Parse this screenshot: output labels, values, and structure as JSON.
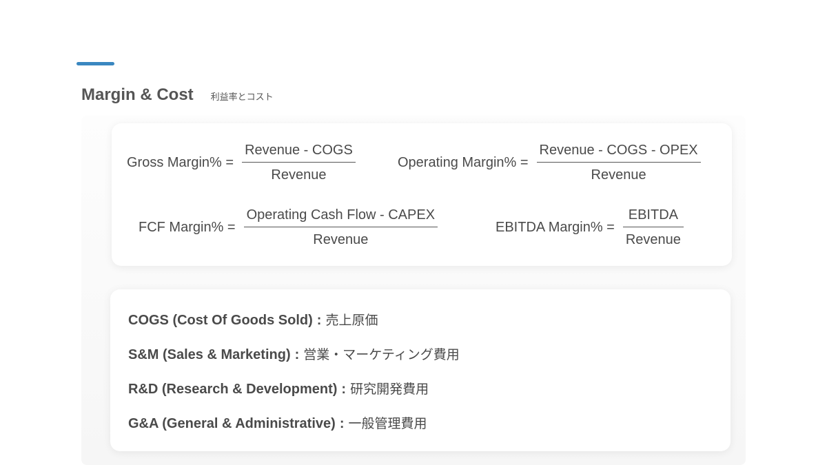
{
  "section": {
    "title": "Margin & Cost",
    "subtitle": "利益率とコスト",
    "accent_color": "#3a87c0"
  },
  "formulas": [
    {
      "lhs": "Gross Margin% =",
      "numerator": "Revenue - COGS",
      "denominator": "Revenue"
    },
    {
      "lhs": "Operating Margin% =",
      "numerator": "Revenue - COGS - OPEX",
      "denominator": "Revenue"
    },
    {
      "lhs": "FCF Margin% =",
      "numerator": "Operating Cash Flow - CAPEX",
      "denominator": "Revenue"
    },
    {
      "lhs": "EBITDA Margin% =",
      "numerator": "EBITDA",
      "denominator": "Revenue"
    }
  ],
  "glossary": [
    {
      "term": "COGS (Cost Of Goods Sold)",
      "separator": ":",
      "japanese": "売上原価"
    },
    {
      "term": "S&M (Sales & Marketing)",
      "separator": ":",
      "japanese": "営業・マーケティング費用"
    },
    {
      "term": "R&D (Research & Development)",
      "separator": ":",
      "japanese": "研究開発費用"
    },
    {
      "term": "G&A (General & Administrative)",
      "separator": ":",
      "japanese": "一般管理費用"
    }
  ]
}
